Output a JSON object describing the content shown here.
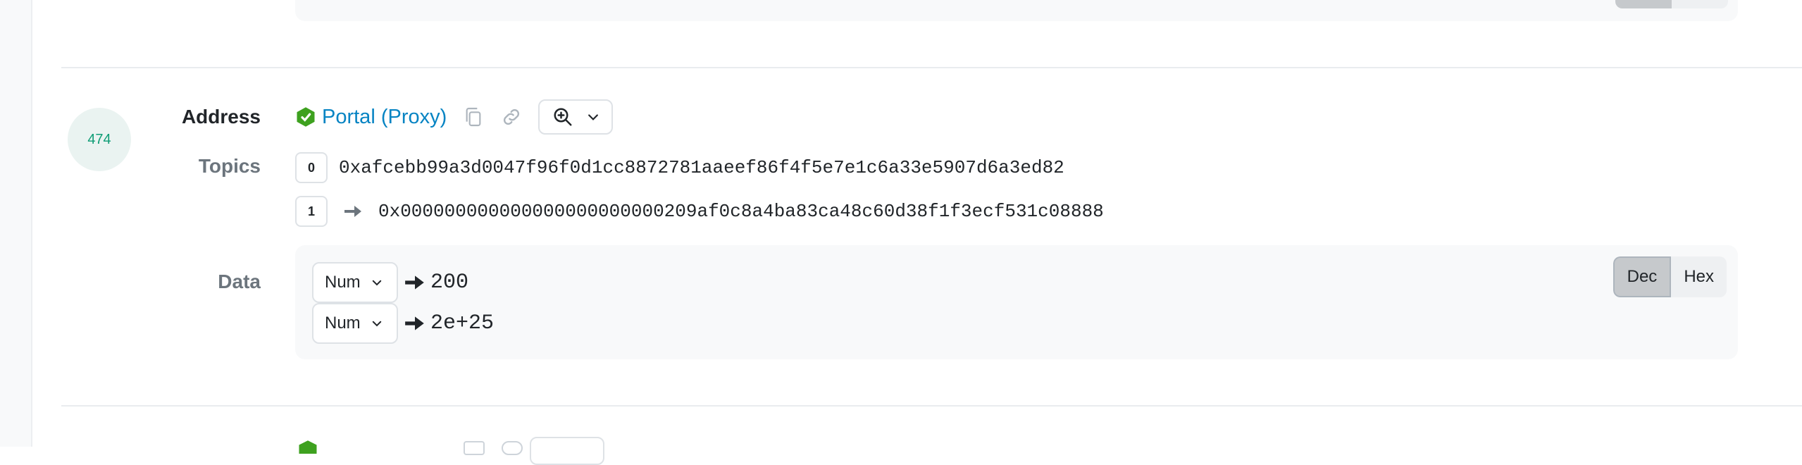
{
  "log_entry": {
    "index": "474",
    "address_label": "Address",
    "address_name": "Portal (Proxy)",
    "topics_label": "Topics",
    "topics": [
      {
        "index": "0",
        "value": "0xafcebb99a3d0047f96f0d1cc8872781aaeef86f4f5e7e1c6a33e5907d6a3ed82",
        "decoded": false
      },
      {
        "index": "1",
        "value": "0x000000000000000000000000209af0c8a4ba83ca48c60d38f1f3ecf531c08888",
        "decoded": true
      }
    ],
    "data_label": "Data",
    "data_rows": [
      {
        "format": "Num",
        "value": "200"
      },
      {
        "format": "Num",
        "value": "2e+25"
      }
    ],
    "toggle": {
      "dec": "Dec",
      "hex": "Hex",
      "selected": "Dec"
    }
  },
  "icons": {
    "contract": "contract-verified-icon",
    "copy": "copy-icon",
    "link": "link-icon",
    "zoom": "zoom-in-icon",
    "chevron": "chevron-down-icon",
    "arrow": "right-arrow-icon"
  },
  "colors": {
    "link": "#0784c3",
    "index_text": "#0f9d76",
    "index_bg": "#eaf3f1",
    "contract_icon": "#3ea11f"
  }
}
